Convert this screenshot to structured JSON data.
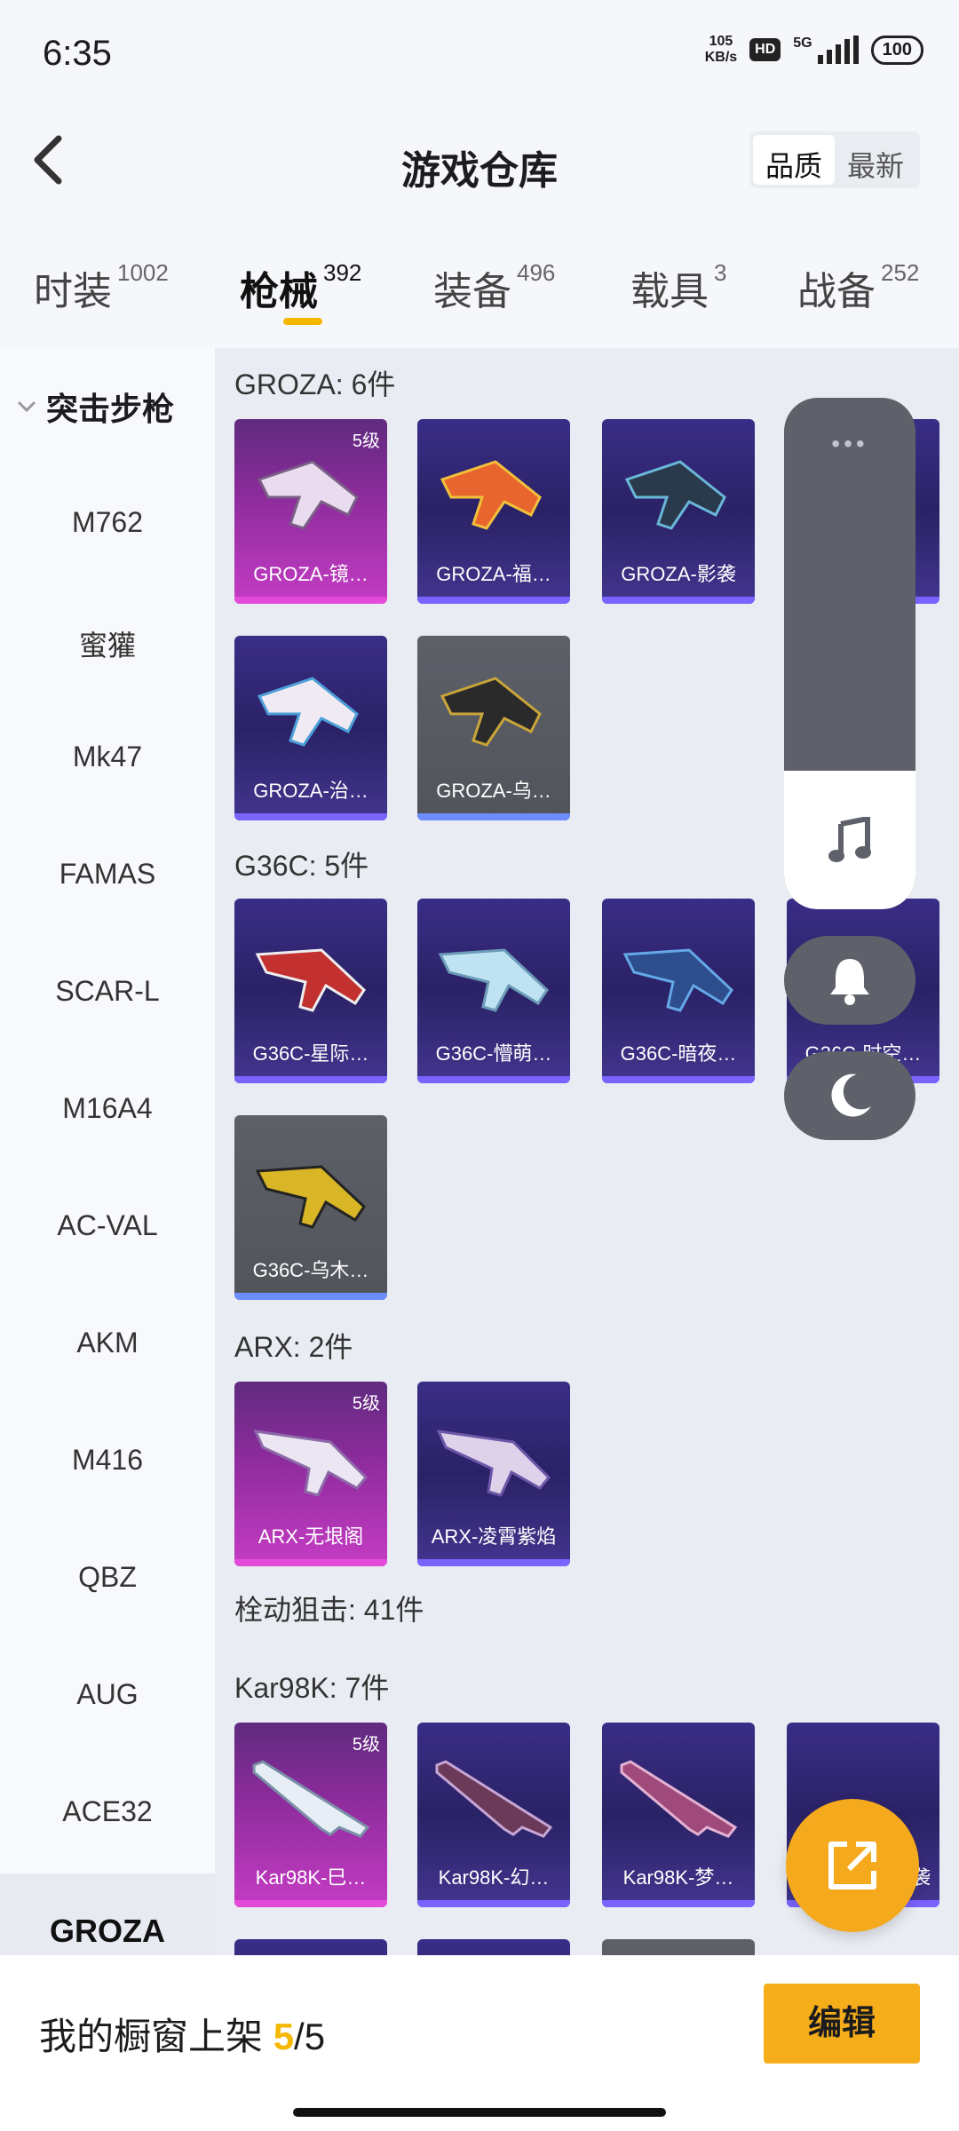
{
  "status": {
    "time": "6:35",
    "net_speed_value": "105",
    "net_speed_unit": "KB/s",
    "hd": "HD",
    "network": "5G",
    "battery": "100"
  },
  "header": {
    "title": "游戏仓库",
    "sort_quality": "品质",
    "sort_latest": "最新"
  },
  "tabs": [
    {
      "label": "时装",
      "count": "1002"
    },
    {
      "label": "枪械",
      "count": "392"
    },
    {
      "label": "装备",
      "count": "496"
    },
    {
      "label": "载具",
      "count": "3"
    },
    {
      "label": "战备",
      "count": "252"
    }
  ],
  "sidebar": {
    "group": "突击步枪",
    "items": [
      "M762",
      "蜜獾",
      "Mk47",
      "FAMAS",
      "SCAR-L",
      "M16A4",
      "AC-VAL",
      "AKM",
      "M416",
      "QBZ",
      "AUG",
      "ACE32",
      "GROZA"
    ]
  },
  "sections": {
    "groza": {
      "title": "GROZA: 6件",
      "cards": [
        "GROZA-镜…",
        "GROZA-福…",
        "GROZA-影袭",
        "GROZA-治…",
        "GROZA-乌…"
      ]
    },
    "g36c": {
      "title": "G36C: 5件",
      "cards": [
        "G36C-星际…",
        "G36C-懵萌…",
        "G36C-暗夜…",
        "G36C-时空…",
        "G36C-乌木…"
      ]
    },
    "arx": {
      "title": "ARX: 2件",
      "cards": [
        "ARX-无垠阁",
        "ARX-凌霄紫焰"
      ]
    },
    "bolt": {
      "title": "栓动狙击: 41件"
    },
    "kar98k": {
      "title": "Kar98K: 7件",
      "cards": [
        "Kar98K-巳…",
        "Kar98K-幻…",
        "Kar98K-梦…",
        "袭"
      ]
    }
  },
  "level_badge": "5级",
  "bottom": {
    "shelf_label": "我的橱窗上架",
    "shelf_current": "5",
    "shelf_sep": "/",
    "shelf_total": "5",
    "edit": "编辑"
  },
  "colors": {
    "accent": "#f5b700",
    "edit_button": "#f5ad1a",
    "card_purple": "#2a2266",
    "card_pink": "#c53cc4"
  }
}
